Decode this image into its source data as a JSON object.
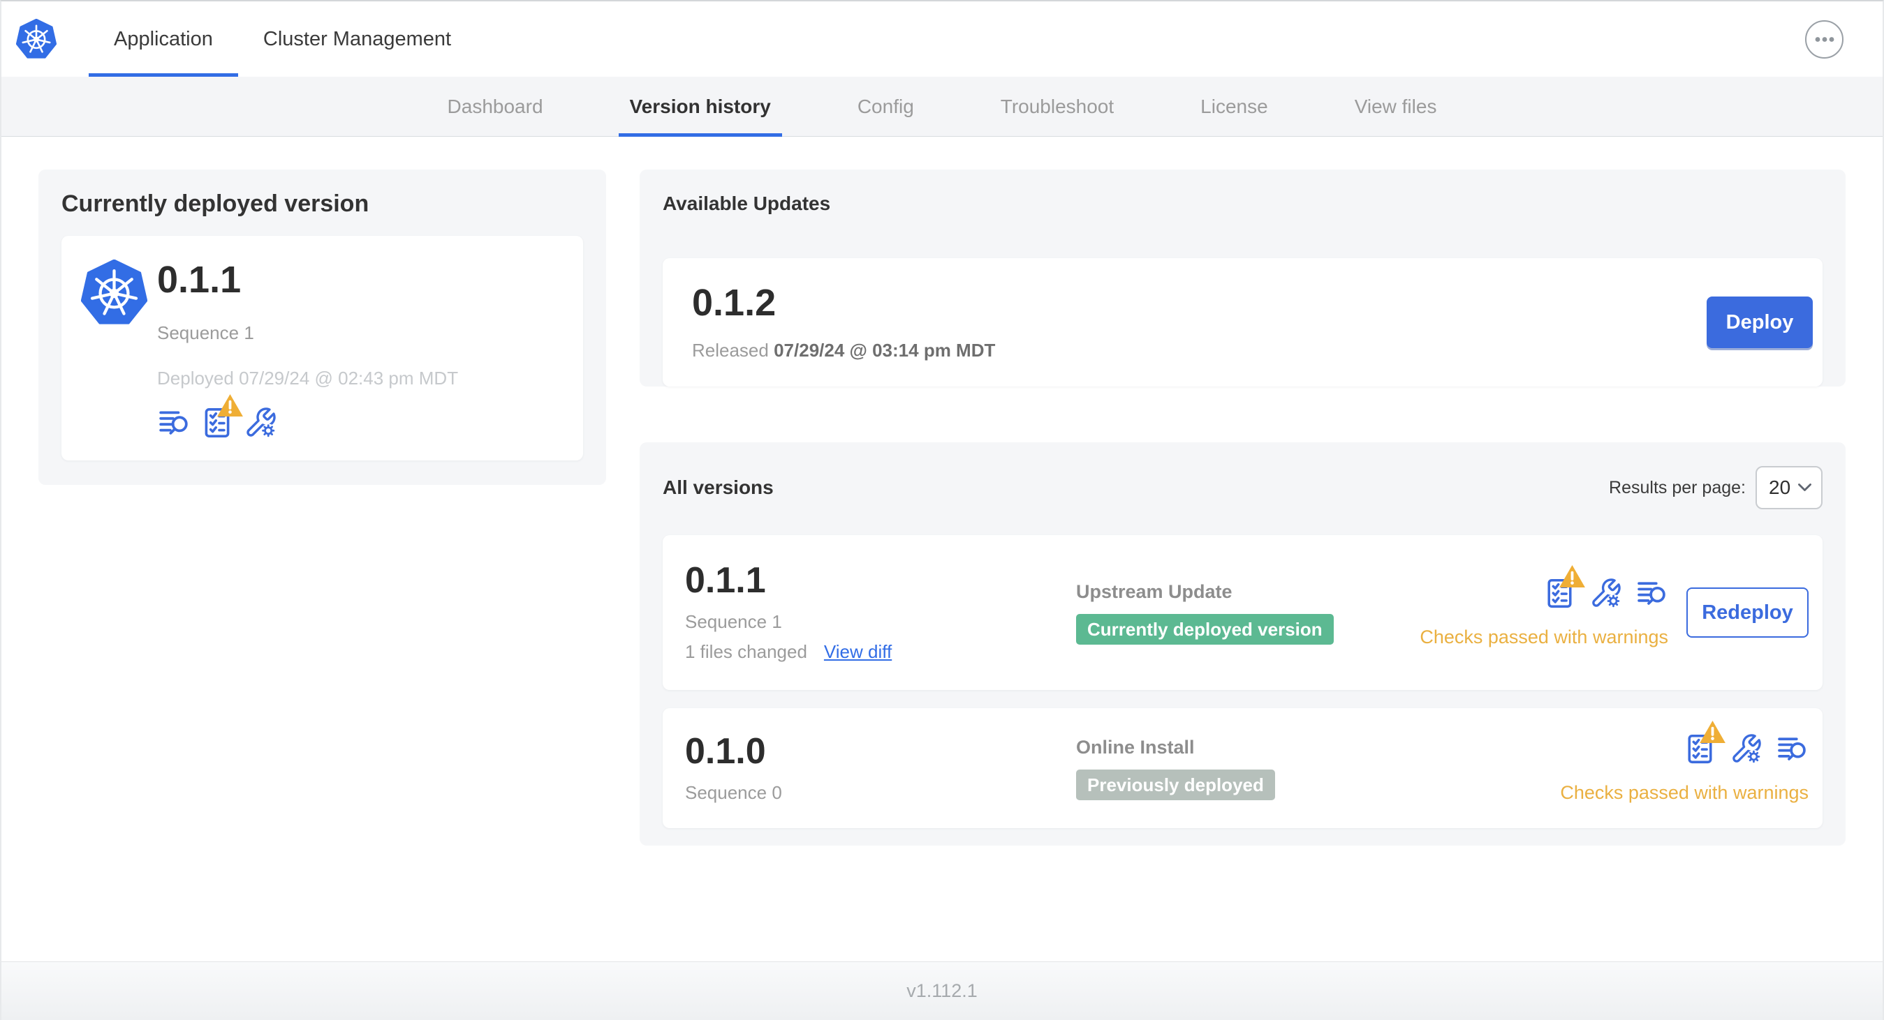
{
  "colors": {
    "accent_blue": "#3b6bde",
    "link_blue": "#326de6",
    "kubernetes_blue": "#326de5",
    "warning_amber_text": "#eab041",
    "warning_triangle": "#efae35",
    "badge_current_green": "#5cb992",
    "badge_previous_gray": "#b6c0bb",
    "panel_background": "#f5f6f8"
  },
  "icons": {
    "kubernetes-logo": "blue heptagon with white ship helm wheel",
    "deploy-logs": "text lines with magnifying glass",
    "preflight-checks": "checklist sheet, amber warning triangle badge",
    "edit-config": "wrench with small gear",
    "more-options": "circled horizontal ellipsis",
    "chevron-down": "select dropdown arrow"
  },
  "top_nav": {
    "tabs": [
      {
        "label": "Application",
        "active": true
      },
      {
        "label": "Cluster Management",
        "active": false
      }
    ]
  },
  "sub_nav": {
    "tabs": [
      {
        "label": "Dashboard",
        "active": false
      },
      {
        "label": "Version history",
        "active": true
      },
      {
        "label": "Config",
        "active": false
      },
      {
        "label": "Troubleshoot",
        "active": false
      },
      {
        "label": "License",
        "active": false
      },
      {
        "label": "View files",
        "active": false
      }
    ]
  },
  "deployed_card": {
    "title": "Currently deployed version",
    "version": "0.1.1",
    "sequence": "Sequence 1",
    "deployed_at": "Deployed 07/29/24 @ 02:43 pm MDT"
  },
  "available_updates": {
    "title": "Available Updates",
    "version": "0.1.2",
    "released_prefix": "Released",
    "released_at": "07/29/24 @ 03:14 pm MDT",
    "deploy_label": "Deploy"
  },
  "all_versions": {
    "title": "All versions",
    "results_per_page_label": "Results per page:",
    "results_per_page_value": "20",
    "rows": [
      {
        "version": "0.1.1",
        "sequence": "Sequence 1",
        "files_changed": "1 files changed",
        "view_diff_label": "View diff",
        "source": "Upstream Update",
        "badge": "Currently deployed version",
        "badge_color": "#5cb992",
        "status": "Checks passed with warnings",
        "action_label": "Redeploy"
      },
      {
        "version": "0.1.0",
        "sequence": "Sequence 0",
        "source": "Online Install",
        "badge": "Previously deployed",
        "badge_color": "#b6c0bb",
        "status": "Checks passed with warnings"
      }
    ]
  },
  "footer": {
    "version": "v1.112.1"
  }
}
